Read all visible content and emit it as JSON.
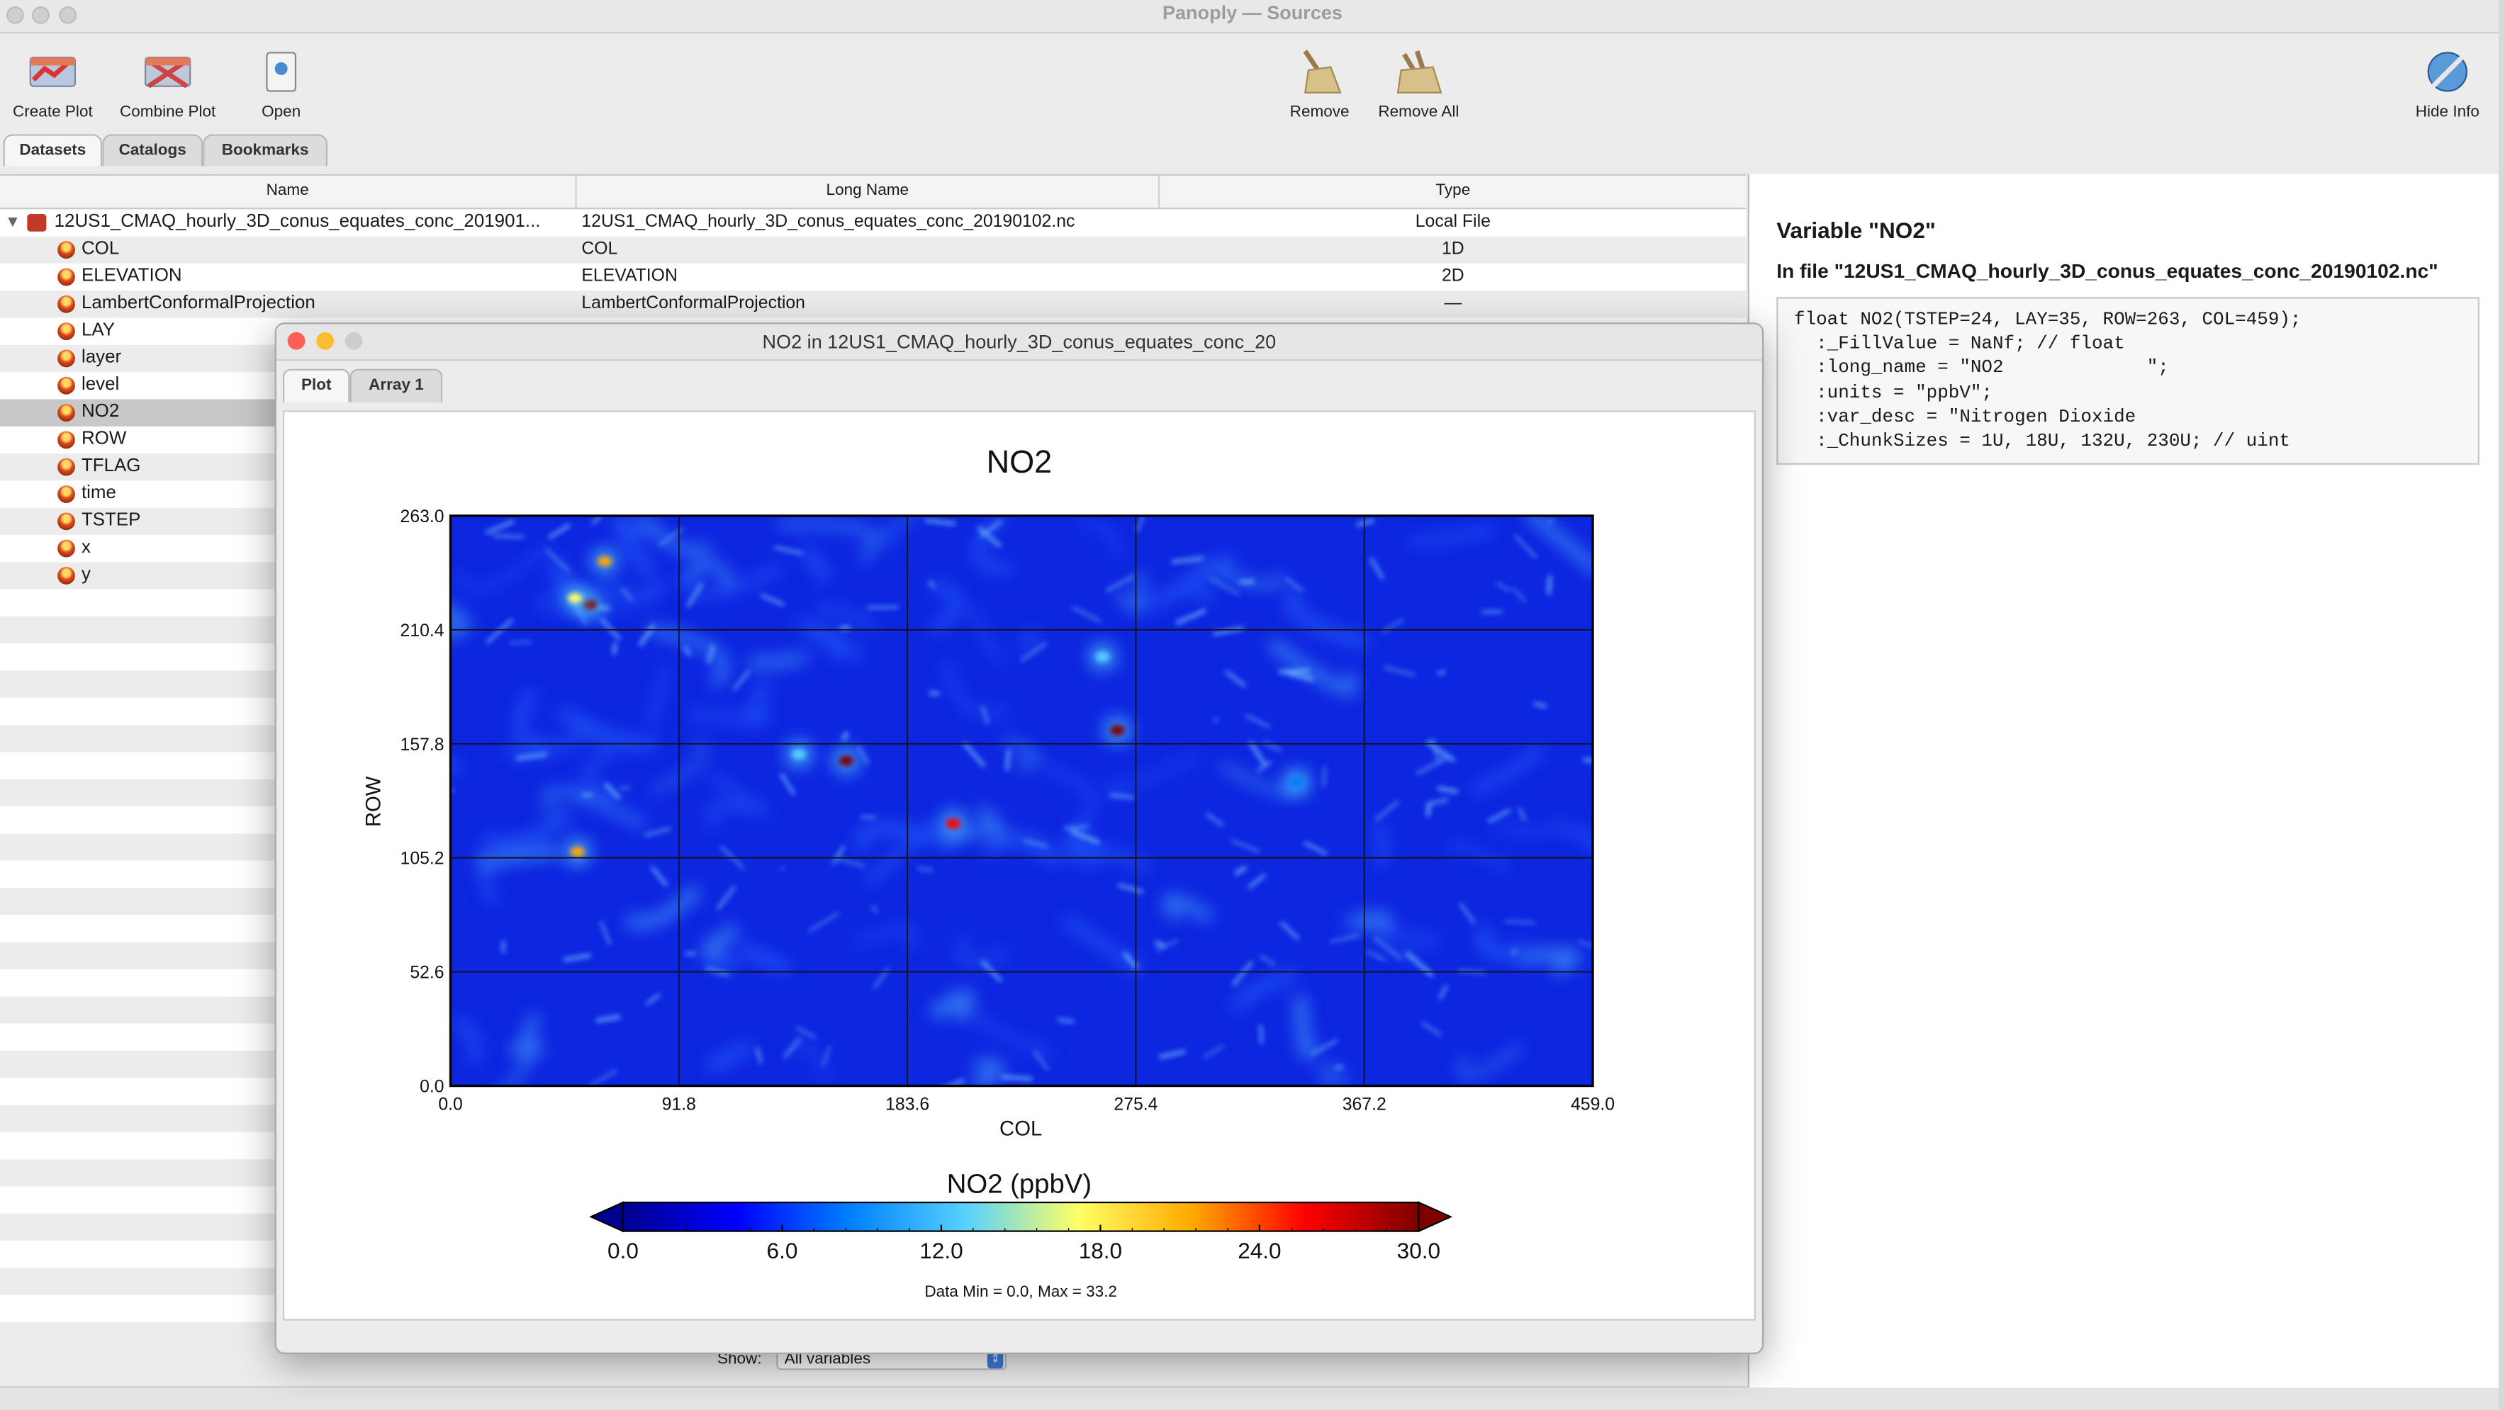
{
  "window": {
    "title": "Panoply — Sources"
  },
  "toolbar": {
    "create_plot": "Create Plot",
    "combine_plot": "Combine Plot",
    "open": "Open",
    "remove": "Remove",
    "remove_all": "Remove All",
    "hide_info": "Hide Info"
  },
  "tabs": [
    "Datasets",
    "Catalogs",
    "Bookmarks"
  ],
  "table": {
    "headers": [
      "Name",
      "Long Name",
      "Type"
    ],
    "dataset": {
      "name": "12US1_CMAQ_hourly_3D_conus_equates_conc_201901...",
      "long_name": "12US1_CMAQ_hourly_3D_conus_equates_conc_20190102.nc",
      "type": "Local File"
    },
    "rows": [
      {
        "name": "COL",
        "long_name": "COL",
        "type": "1D"
      },
      {
        "name": "ELEVATION",
        "long_name": "ELEVATION",
        "type": "2D"
      },
      {
        "name": "LambertConformalProjection",
        "long_name": "LambertConformalProjection",
        "type": "—"
      },
      {
        "name": "LAY",
        "long_name": "",
        "type": ""
      },
      {
        "name": "layer",
        "long_name": "",
        "type": ""
      },
      {
        "name": "level",
        "long_name": "",
        "type": ""
      },
      {
        "name": "NO2",
        "long_name": "",
        "type": ""
      },
      {
        "name": "ROW",
        "long_name": "",
        "type": ""
      },
      {
        "name": "TFLAG",
        "long_name": "",
        "type": ""
      },
      {
        "name": "time",
        "long_name": "",
        "type": ""
      },
      {
        "name": "TSTEP",
        "long_name": "",
        "type": ""
      },
      {
        "name": "x",
        "long_name": "",
        "type": ""
      },
      {
        "name": "y",
        "long_name": "",
        "type": ""
      }
    ],
    "selected_row": "NO2"
  },
  "show_filter": {
    "label": "Show:",
    "value": "All variables"
  },
  "info": {
    "heading": "Variable \"NO2\"",
    "file_line": "In file \"12US1_CMAQ_hourly_3D_conus_equates_conc_20190102.nc\"",
    "code_lines": [
      "float NO2(TSTEP=24, LAY=35, ROW=263, COL=459);",
      "  :_FillValue = NaNf; // float",
      "  :long_name = \"NO2             \";",
      "  :units = \"ppbV\";",
      "  :var_desc = \"Nitrogen Dioxide",
      "  :_ChunkSizes = 1U, 18U, 132U, 230U; // uint"
    ]
  },
  "plot_window": {
    "title": "NO2 in 12US1_CMAQ_hourly_3D_conus_equates_conc_20",
    "tabs": [
      "Plot",
      "Array 1"
    ]
  },
  "chart_data": {
    "type": "heatmap",
    "title": "NO2",
    "xlabel": "COL",
    "ylabel": "ROW",
    "xlim": [
      0.0,
      459.0
    ],
    "ylim": [
      0.0,
      263.0
    ],
    "x_ticks": [
      "0.0",
      "91.8",
      "183.6",
      "275.4",
      "367.2",
      "459.0"
    ],
    "y_ticks": [
      "0.0",
      "52.6",
      "105.2",
      "157.8",
      "210.4",
      "263.0"
    ],
    "grid": true,
    "colorbar": {
      "title": "NO2 (ppbV)",
      "min": 0.0,
      "max": 30.0,
      "ticks": [
        "0.0",
        "6.0",
        "12.0",
        "18.0",
        "24.0",
        "30.0"
      ],
      "colors": [
        "#00008f",
        "#0000ff",
        "#0080ff",
        "#55d0ff",
        "#ffff66",
        "#ffaa00",
        "#ff0000",
        "#7f0000"
      ]
    },
    "data_range_text": "Data Min = 0.0, Max = 33.2",
    "hotspots": [
      {
        "col": 62,
        "row": 242,
        "value": 22
      },
      {
        "col": 56,
        "row": 222,
        "value": 30
      },
      {
        "col": 50,
        "row": 225,
        "value": 18
      },
      {
        "col": 159,
        "row": 150,
        "value": 32
      },
      {
        "col": 202,
        "row": 121,
        "value": 26
      },
      {
        "col": 268,
        "row": 164,
        "value": 28
      },
      {
        "col": 51,
        "row": 108,
        "value": 20
      },
      {
        "col": 140,
        "row": 153,
        "value": 14
      },
      {
        "col": 262,
        "row": 198,
        "value": 11
      },
      {
        "col": 340,
        "row": 140,
        "value": 10
      }
    ]
  }
}
